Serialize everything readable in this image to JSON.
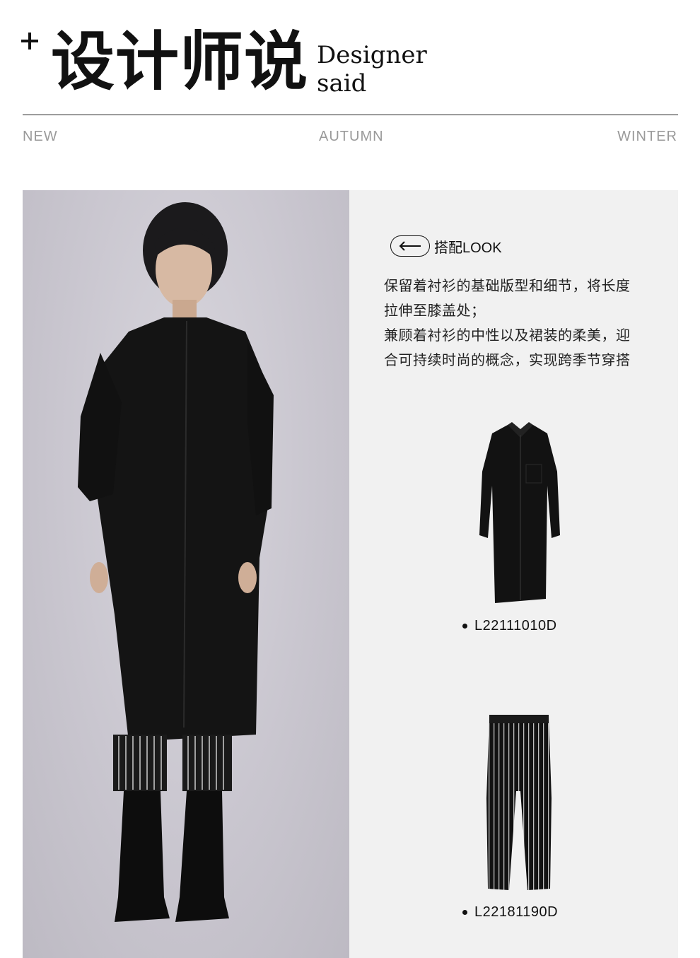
{
  "header": {
    "title_cn": "设计师说",
    "title_en_line1": "Designer",
    "title_en_line2": "said"
  },
  "season": {
    "left": "NEW",
    "center": "AUTUMN",
    "right": "WINTER"
  },
  "look": {
    "label": "搭配LOOK",
    "arrow_icon": "left-arrow-icon",
    "description": [
      "保留着衬衫的基础版型和细节，将长度",
      "拉伸至膝盖处；",
      "兼顾着衬衫的中性以及裙装的柔美，迎",
      "合可持续时尚的概念，实现跨季节穿搭"
    ]
  },
  "products": [
    {
      "code": "L22111010D",
      "item_icon": "long-shirt-dress-icon"
    },
    {
      "code": "L22181190D",
      "item_icon": "striped-trousers-icon"
    }
  ],
  "colors": {
    "text": "#111111",
    "muted": "#9a9a9a",
    "panel": "#f1f1f1",
    "photo_bg": "#c9c6cf"
  }
}
